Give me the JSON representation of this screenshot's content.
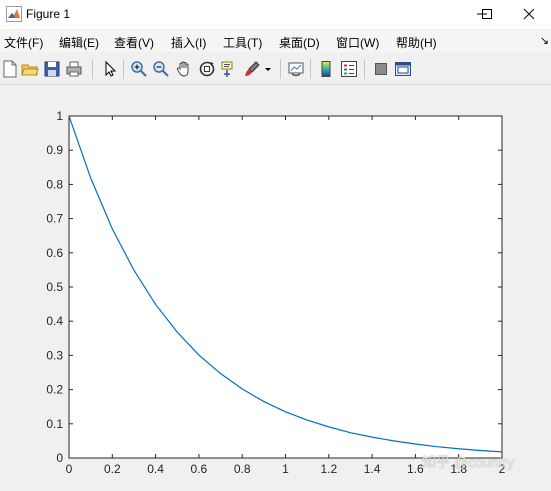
{
  "window": {
    "title": "Figure 1"
  },
  "menu": [
    "文件(F)",
    "编辑(E)",
    "查看(V)",
    "插入(I)",
    "工具(T)",
    "桌面(D)",
    "窗口(W)",
    "帮助(H)"
  ],
  "toolbar": {
    "buttons": [
      "new-figure",
      "open-file",
      "save",
      "print",
      "select-pointer",
      "zoom-in",
      "zoom-out",
      "pan",
      "rotate-3d",
      "data-cursor",
      "brush",
      "link-plot",
      "insert-colorbar",
      "insert-legend",
      "hide-plot-tools",
      "show-plot-tools"
    ]
  },
  "watermark": "知乎 @country",
  "colors": {
    "line": "#0072bd",
    "axes_bg": "#ffffff",
    "figure_bg": "#f0f0f0"
  },
  "chart_data": {
    "type": "line",
    "x": [
      0,
      0.1,
      0.2,
      0.3,
      0.4,
      0.5,
      0.6,
      0.7,
      0.8,
      0.9,
      1.0,
      1.1,
      1.2,
      1.3,
      1.4,
      1.5,
      1.6,
      1.7,
      1.8,
      1.9,
      2.0
    ],
    "series": [
      {
        "values": [
          1.0,
          0.819,
          0.67,
          0.549,
          0.449,
          0.368,
          0.301,
          0.247,
          0.202,
          0.165,
          0.135,
          0.111,
          0.091,
          0.074,
          0.061,
          0.05,
          0.041,
          0.033,
          0.027,
          0.022,
          0.018
        ]
      }
    ],
    "xlim": [
      0,
      2
    ],
    "ylim": [
      0,
      1
    ],
    "xticks": [
      "0",
      "0.2",
      "0.4",
      "0.6",
      "0.8",
      "1",
      "1.2",
      "1.4",
      "1.6",
      "1.8",
      "2"
    ],
    "yticks": [
      "0",
      "0.1",
      "0.2",
      "0.3",
      "0.4",
      "0.5",
      "0.6",
      "0.7",
      "0.8",
      "0.9",
      "1"
    ],
    "grid": false
  }
}
